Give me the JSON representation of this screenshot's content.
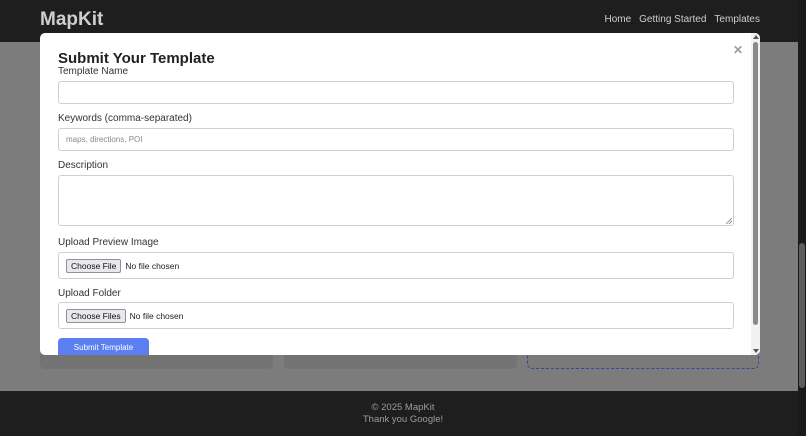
{
  "navbar": {
    "brand": "MapKit",
    "links": [
      "Home",
      "Getting Started",
      "Templates"
    ]
  },
  "modal": {
    "title": "Submit Your Template",
    "close_icon": "close-icon",
    "fields": {
      "template_name": {
        "label": "Template Name",
        "value": "",
        "placeholder": ""
      },
      "keywords": {
        "label": "Keywords (comma-separated)",
        "value": "",
        "placeholder": "maps, directions, POI"
      },
      "description": {
        "label": "Description",
        "value": ""
      },
      "preview_image": {
        "label": "Upload Preview Image",
        "button": "Choose File",
        "status": "No file chosen"
      },
      "folder": {
        "label": "Upload Folder",
        "button": "Choose Files",
        "status": "No file chosen"
      }
    },
    "submit_label": "Submit Template"
  },
  "footer": {
    "copyright": "© 2025 MapKit",
    "thanks": "Thank you Google!"
  },
  "colors": {
    "navbar_bg": "#1e1e1e",
    "overlay": "#7b7b7b",
    "accent": "#5b7ff0"
  }
}
